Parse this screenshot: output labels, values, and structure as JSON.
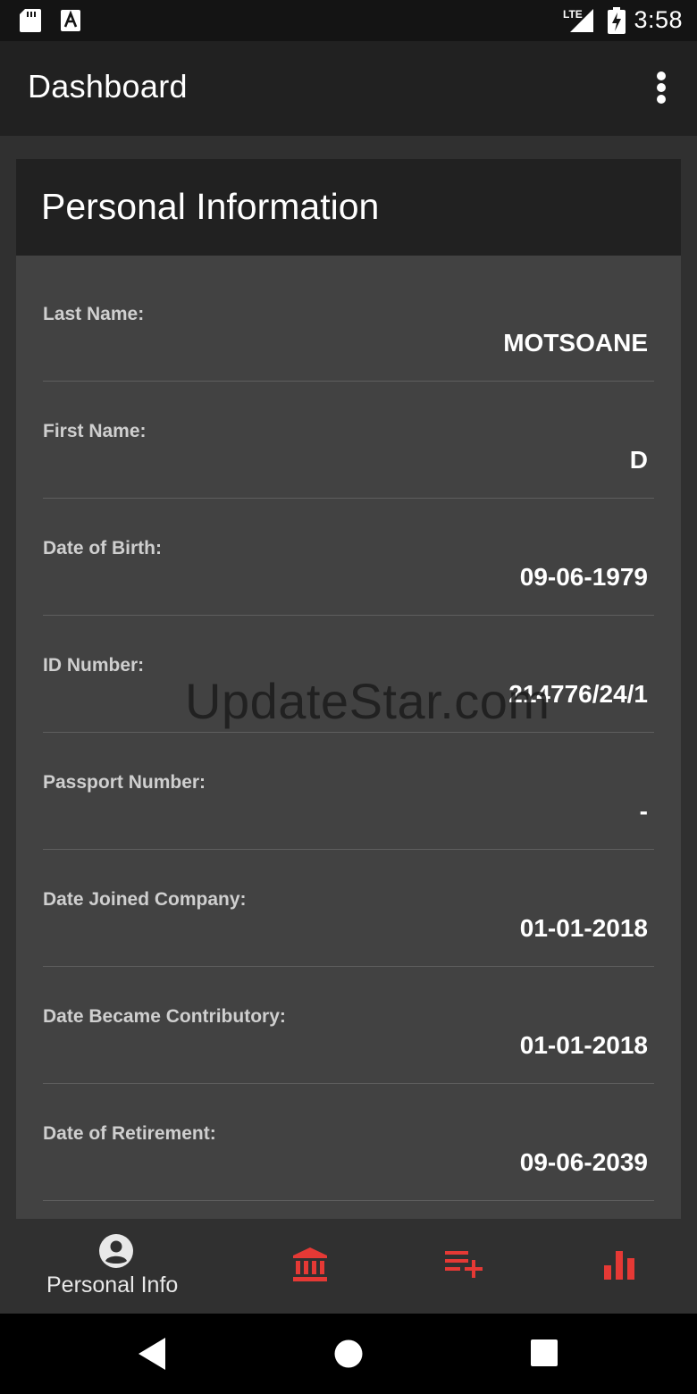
{
  "status_bar": {
    "time": "3:58",
    "network": "LTE"
  },
  "app_bar": {
    "title": "Dashboard"
  },
  "card": {
    "title": "Personal Information",
    "rows": [
      {
        "label": "Last Name:",
        "value": "MOTSOANE"
      },
      {
        "label": "First Name:",
        "value": "D"
      },
      {
        "label": "Date of Birth:",
        "value": "09-06-1979"
      },
      {
        "label": "ID Number:",
        "value": "214776/24/1"
      },
      {
        "label": "Passport Number:",
        "value": "-"
      },
      {
        "label": "Date Joined Company:",
        "value": "01-01-2018"
      },
      {
        "label": "Date Became Contributory:",
        "value": "01-01-2018"
      },
      {
        "label": "Date of Retirement:",
        "value": "09-06-2039"
      }
    ]
  },
  "watermark": "UpdateStar.com",
  "bottom_nav": {
    "items": [
      {
        "label": "Personal Info",
        "icon": "account-circle-icon"
      },
      {
        "icon": "bank-icon"
      },
      {
        "icon": "playlist-add-icon"
      },
      {
        "icon": "bar-chart-icon"
      }
    ]
  },
  "colors": {
    "status_bar": "#141414",
    "app_bar": "#212121",
    "background": "#303030",
    "card": "#424242",
    "accent": "#e53935",
    "text": "#ffffff",
    "label_text": "#cfcfcf"
  }
}
